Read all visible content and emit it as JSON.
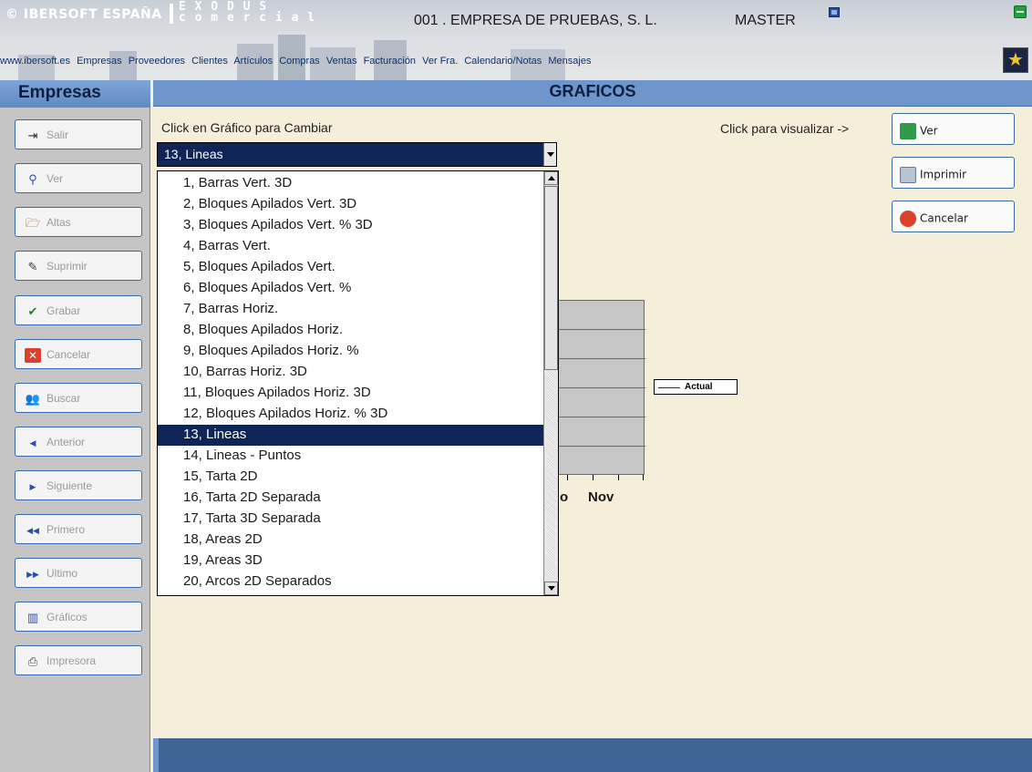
{
  "header": {
    "brand": "© IBERSOFT ESPAÑA",
    "product_line1": "E X O D U S",
    "product_line2": "c o m e r c i a l",
    "company": "001 . EMPRESA DE PRUEBAS, S. L.",
    "user": "MASTER"
  },
  "nav": [
    "www.ibersoft.es",
    "Empresas",
    "Proveedores",
    "Clientes",
    "Artículos",
    "Compras",
    "Ventas",
    "Facturación",
    "Ver Fra.",
    "Calendario/Notas",
    "Mensajes"
  ],
  "sidebar": {
    "title": "Empresas",
    "buttons": [
      {
        "label": "Salir",
        "icon": "exit-icon"
      },
      {
        "label": "Ver",
        "icon": "magnifier-icon"
      },
      {
        "label": "Altas",
        "icon": "folder-open-icon"
      },
      {
        "label": "Suprimir",
        "icon": "eraser-icon"
      },
      {
        "label": "Grabar",
        "icon": "checkmark-icon"
      },
      {
        "label": "Cancelar",
        "icon": "x-icon"
      },
      {
        "label": "Buscar",
        "icon": "people-icon"
      },
      {
        "label": "Anterior",
        "icon": "prev-arrow-icon"
      },
      {
        "label": "Siguiente",
        "icon": "next-arrow-icon"
      },
      {
        "label": "Primero",
        "icon": "first-arrow-icon"
      },
      {
        "label": "Ultimo",
        "icon": "last-arrow-icon"
      },
      {
        "label": "Gráficos",
        "icon": "bar-chart-icon"
      },
      {
        "label": "Impresora",
        "icon": "printer-icon"
      }
    ]
  },
  "main": {
    "title": "GRAFICOS",
    "instruction": "Click en Gráfico para Cambiar",
    "view_hint": "Click para visualizar ->",
    "select_value": "13, Lineas",
    "actions": [
      {
        "label": "Ver",
        "icon": "refresh-icon"
      },
      {
        "label": "Imprimir",
        "icon": "printer-icon"
      },
      {
        "label": "Cancelar",
        "icon": "cancel-icon"
      }
    ]
  },
  "chart_type_options": [
    "1, Barras Vert. 3D",
    "2, Bloques Apilados Vert. 3D",
    "3, Bloques Apilados Vert. %  3D",
    "4, Barras Vert.",
    "5, Bloques Apilados Vert.",
    "6, Bloques Apilados Vert. %",
    "7, Barras Horiz.",
    "8, Bloques Apilados Horiz.",
    "9, Bloques Apilados Horiz. %",
    "10, Barras Horiz. 3D",
    "11, Bloques Apilados Horiz. 3D",
    "12, Bloques Apilados Horiz. %  3D",
    "13, Lineas",
    "14, Lineas - Puntos",
    "15, Tarta 2D",
    "16, Tarta 2D Separada",
    "17, Tarta 3D Separada",
    "18, Areas 2D",
    "19, Areas 3D",
    "20, Arcos 2D Separados"
  ],
  "selected_index": 12,
  "background_chart": {
    "x_labels_visible": [
      "o",
      "Nov"
    ],
    "legend": "Actual"
  },
  "colors": {
    "selection": "#0f2457",
    "accent_blue": "#6f95cd",
    "background": "#f5eed9"
  }
}
